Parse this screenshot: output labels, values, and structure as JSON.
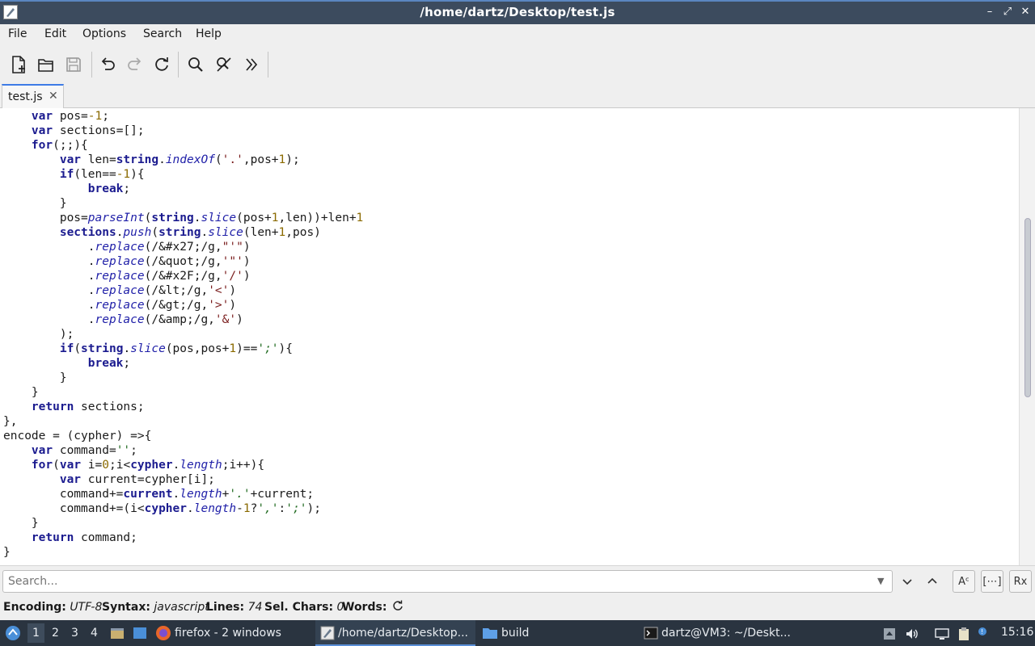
{
  "window": {
    "title": "/home/dartz/Desktop/test.js",
    "controls": [
      "minimize",
      "maximize",
      "close"
    ]
  },
  "menu": [
    "File",
    "Edit",
    "Options",
    "Search",
    "Help"
  ],
  "toolbar": {
    "icons": [
      "new-document-icon",
      "open-folder-icon",
      "save-icon",
      "undo-icon",
      "redo-icon",
      "reload-icon",
      "search-icon",
      "replace-icon",
      "more-icon"
    ]
  },
  "tabs": [
    {
      "label": "test.js",
      "close": "✕"
    }
  ],
  "editor": {
    "lines": [
      [
        [
          "    ",
          ""
        ],
        [
          "var",
          "kw"
        ],
        [
          " pos=",
          ""
        ],
        [
          "-1",
          "num"
        ],
        [
          ";",
          ""
        ]
      ],
      [
        [
          "    ",
          ""
        ],
        [
          "var",
          "kw"
        ],
        [
          " sections=[];",
          ""
        ]
      ],
      [
        [
          "    ",
          ""
        ],
        [
          "for",
          "kw"
        ],
        [
          "(;;){",
          ""
        ]
      ],
      [
        [
          "        ",
          ""
        ],
        [
          "var",
          "kw"
        ],
        [
          " len=",
          ""
        ],
        [
          "string",
          "kw"
        ],
        [
          ".",
          ""
        ],
        [
          "indexOf",
          "fn"
        ],
        [
          "(",
          ""
        ],
        [
          "'.'",
          "str"
        ],
        [
          ",pos+",
          ""
        ],
        [
          "1",
          "num"
        ],
        [
          ");",
          ""
        ]
      ],
      [
        [
          "        ",
          ""
        ],
        [
          "if",
          "kw"
        ],
        [
          "(len==",
          ""
        ],
        [
          "-1",
          "num"
        ],
        [
          "){",
          ""
        ]
      ],
      [
        [
          "            ",
          ""
        ],
        [
          "break",
          "kw"
        ],
        [
          ";",
          ""
        ]
      ],
      [
        [
          "        }",
          ""
        ]
      ],
      [
        [
          "        pos=",
          ""
        ],
        [
          "parseInt",
          "fn"
        ],
        [
          "(",
          ""
        ],
        [
          "string",
          "kw"
        ],
        [
          ".",
          ""
        ],
        [
          "slice",
          "fn"
        ],
        [
          "(pos+",
          ""
        ],
        [
          "1",
          "num"
        ],
        [
          ",len))+len+",
          ""
        ],
        [
          "1",
          "num"
        ]
      ],
      [
        [
          "        ",
          ""
        ],
        [
          "sections",
          "kw"
        ],
        [
          ".",
          ""
        ],
        [
          "push",
          "fn"
        ],
        [
          "(",
          ""
        ],
        [
          "string",
          "kw"
        ],
        [
          ".",
          ""
        ],
        [
          "slice",
          "fn"
        ],
        [
          "(len+",
          ""
        ],
        [
          "1",
          "num"
        ],
        [
          ",pos)",
          ""
        ]
      ],
      [
        [
          "            .",
          ""
        ],
        [
          "replace",
          "fn"
        ],
        [
          "(/&#x27;/g,",
          ""
        ],
        [
          "\"'\"",
          "str"
        ],
        [
          ")",
          ""
        ]
      ],
      [
        [
          "            .",
          ""
        ],
        [
          "replace",
          "fn"
        ],
        [
          "(/&quot;/g,",
          ""
        ],
        [
          "'\"'",
          "str"
        ],
        [
          ")",
          ""
        ]
      ],
      [
        [
          "            .",
          ""
        ],
        [
          "replace",
          "fn"
        ],
        [
          "(/&#x2F;/g,",
          ""
        ],
        [
          "'/'",
          "str"
        ],
        [
          ")",
          ""
        ]
      ],
      [
        [
          "            .",
          ""
        ],
        [
          "replace",
          "fn"
        ],
        [
          "(/&lt;/g,",
          ""
        ],
        [
          "'<'",
          "str"
        ],
        [
          ")",
          ""
        ]
      ],
      [
        [
          "            .",
          ""
        ],
        [
          "replace",
          "fn"
        ],
        [
          "(/&gt;/g,",
          ""
        ],
        [
          "'>'",
          "str"
        ],
        [
          ")",
          ""
        ]
      ],
      [
        [
          "            .",
          ""
        ],
        [
          "replace",
          "fn"
        ],
        [
          "(/&amp;/g,",
          ""
        ],
        [
          "'&'",
          "str"
        ],
        [
          ")",
          ""
        ]
      ],
      [
        [
          "        );",
          ""
        ]
      ],
      [
        [
          "        ",
          ""
        ],
        [
          "if",
          "kw"
        ],
        [
          "(",
          ""
        ],
        [
          "string",
          "kw"
        ],
        [
          ".",
          ""
        ],
        [
          "slice",
          "fn"
        ],
        [
          "(pos,pos+",
          ""
        ],
        [
          "1",
          "num"
        ],
        [
          ")==",
          ""
        ],
        [
          "';'",
          "str2"
        ],
        [
          "){",
          ""
        ]
      ],
      [
        [
          "            ",
          ""
        ],
        [
          "break",
          "kw"
        ],
        [
          ";",
          ""
        ]
      ],
      [
        [
          "        }",
          ""
        ]
      ],
      [
        [
          "    }",
          ""
        ]
      ],
      [
        [
          "    ",
          ""
        ],
        [
          "return",
          "kw"
        ],
        [
          " sections;",
          ""
        ]
      ],
      [
        [
          "},",
          ""
        ]
      ],
      [
        [
          "encode = (cypher) =>{",
          ""
        ]
      ],
      [
        [
          "    ",
          ""
        ],
        [
          "var",
          "kw"
        ],
        [
          " command=",
          ""
        ],
        [
          "''",
          "str2"
        ],
        [
          ";",
          ""
        ]
      ],
      [
        [
          "    ",
          ""
        ],
        [
          "for",
          "kw"
        ],
        [
          "(",
          ""
        ],
        [
          "var",
          "kw"
        ],
        [
          " i=",
          ""
        ],
        [
          "0",
          "num"
        ],
        [
          ";i<",
          ""
        ],
        [
          "cypher",
          "kw"
        ],
        [
          ".",
          ""
        ],
        [
          "length",
          "fn"
        ],
        [
          ";i++){",
          ""
        ]
      ],
      [
        [
          "        ",
          ""
        ],
        [
          "var",
          "kw"
        ],
        [
          " current=cypher[i];",
          ""
        ]
      ],
      [
        [
          "        command+=",
          ""
        ],
        [
          "current",
          "kw"
        ],
        [
          ".",
          ""
        ],
        [
          "length",
          "fn"
        ],
        [
          "+",
          ""
        ],
        [
          "'.'",
          "str2"
        ],
        [
          "+current;",
          ""
        ]
      ],
      [
        [
          "        command+=(i<",
          ""
        ],
        [
          "cypher",
          "kw"
        ],
        [
          ".",
          ""
        ],
        [
          "length",
          "fn"
        ],
        [
          "-",
          ""
        ],
        [
          "1",
          "num"
        ],
        [
          "?",
          ""
        ],
        [
          "','",
          "str2"
        ],
        [
          ":",
          ""
        ],
        [
          "';'",
          "str2"
        ],
        [
          ");",
          ""
        ]
      ],
      [
        [
          "    }",
          ""
        ]
      ],
      [
        [
          "    ",
          ""
        ],
        [
          "return",
          "kw"
        ],
        [
          " command;",
          ""
        ]
      ],
      [
        [
          "}",
          ""
        ]
      ]
    ]
  },
  "search": {
    "placeholder": "Search...",
    "buttons": {
      "next": "⌄",
      "prev": "⌃",
      "match_case": "Aᶜ",
      "whole_word": "[⋯]",
      "regex": "Rx"
    }
  },
  "status": {
    "encoding_label": "Encoding:",
    "encoding": "UTF-8",
    "syntax_label": "Syntax:",
    "syntax": "javascript",
    "lines_label": "Lines:",
    "lines": "74",
    "sel_label": "Sel. Chars:",
    "sel": "0",
    "words_label": "Words:"
  },
  "taskbar": {
    "workspaces": [
      "1",
      "2",
      "3",
      "4"
    ],
    "tasks": [
      {
        "label": "firefox - 2 windows",
        "icon": "firefox-icon"
      },
      {
        "label": "/home/dartz/Desktop...",
        "icon": "text-editor-icon",
        "active": true
      },
      {
        "label": "build",
        "icon": "folder-icon"
      },
      {
        "label": "dartz@VM3: ~/Deskt...",
        "icon": "terminal-icon"
      }
    ],
    "clock": "15:16"
  },
  "colors": {
    "accent": "#3d7be6",
    "titlebar": "#3c4b5e",
    "taskbar": "#2a3440"
  }
}
